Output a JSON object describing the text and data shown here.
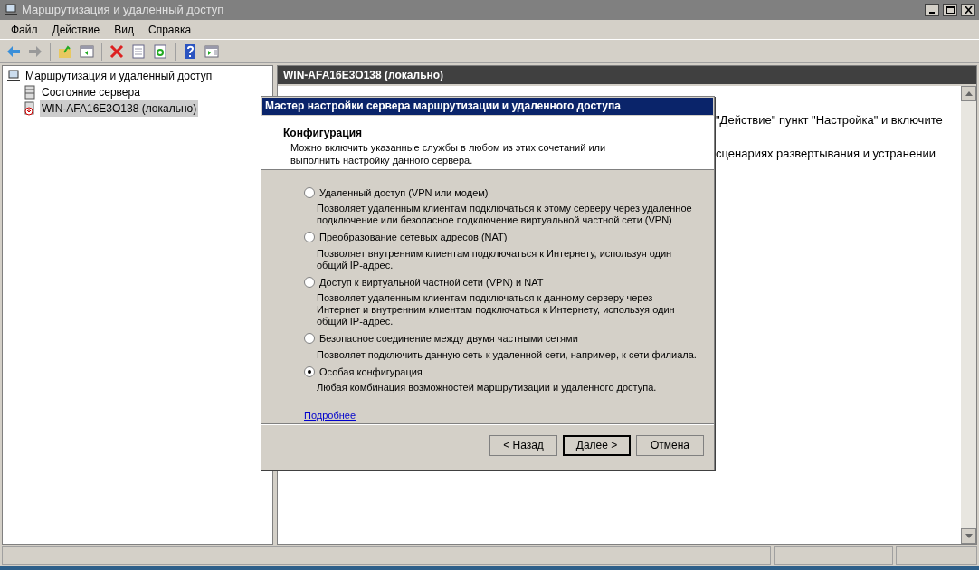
{
  "window": {
    "title": "Маршрутизация и удаленный доступ"
  },
  "menu": [
    "Файл",
    "Действие",
    "Вид",
    "Справка"
  ],
  "tree": {
    "label": "Маршрутизация и удаленный доступ",
    "selected": false,
    "children": [
      {
        "label": "Состояние сервера",
        "kind": "status",
        "selected": false
      },
      {
        "label": "WIN-AFA16E3O138 (локально)",
        "kind": "server",
        "selected": true
      }
    ]
  },
  "pane": {
    "header": "WIN-AFA16E3O138 (локально)",
    "lines": [
      "\"Действие\" пункт \"Настройка\" и включите",
      "сценариях развертывания и устранении"
    ]
  },
  "dialog": {
    "title": "Мастер настройки сервера маршрутизации и удаленного доступа",
    "heading": "Конфигурация",
    "subtitle": "Можно включить указанные службы в любом из этих сочетаний или выполнить настройку данного сервера.",
    "options": [
      {
        "label": "Удаленный доступ (VPN или модем)",
        "description": "Позволяет удаленным клиентам подключаться к этому серверу через удаленное подключение или безопасное подключение виртуальной частной сети (VPN)",
        "selected": false
      },
      {
        "label": "Преобразование сетевых адресов (NAT)",
        "description": "Позволяет внутренним клиентам подключаться к Интернету, используя один общий IP-адрес.",
        "selected": false
      },
      {
        "label": "Доступ к виртуальной частной сети (VPN) и NAT",
        "description": "Позволяет удаленным клиентам подключаться к данному серверу через Интернет и внутренним клиентам подключаться к Интернету, используя один общий IP-адрес.",
        "selected": false
      },
      {
        "label": "Безопасное соединение между двумя частными сетями",
        "description": "Позволяет подключить данную сеть к удаленной сети, например, к сети филиала.",
        "selected": false
      },
      {
        "label": "Особая конфигурация",
        "description": "Любая комбинация возможностей маршрутизации и удаленного доступа.",
        "selected": true
      }
    ],
    "link": "Подробнее",
    "buttons": [
      {
        "label": "< Назад",
        "default": false
      },
      {
        "label": "Далее >",
        "default": true
      },
      {
        "label": "Отмена",
        "default": false
      }
    ]
  }
}
